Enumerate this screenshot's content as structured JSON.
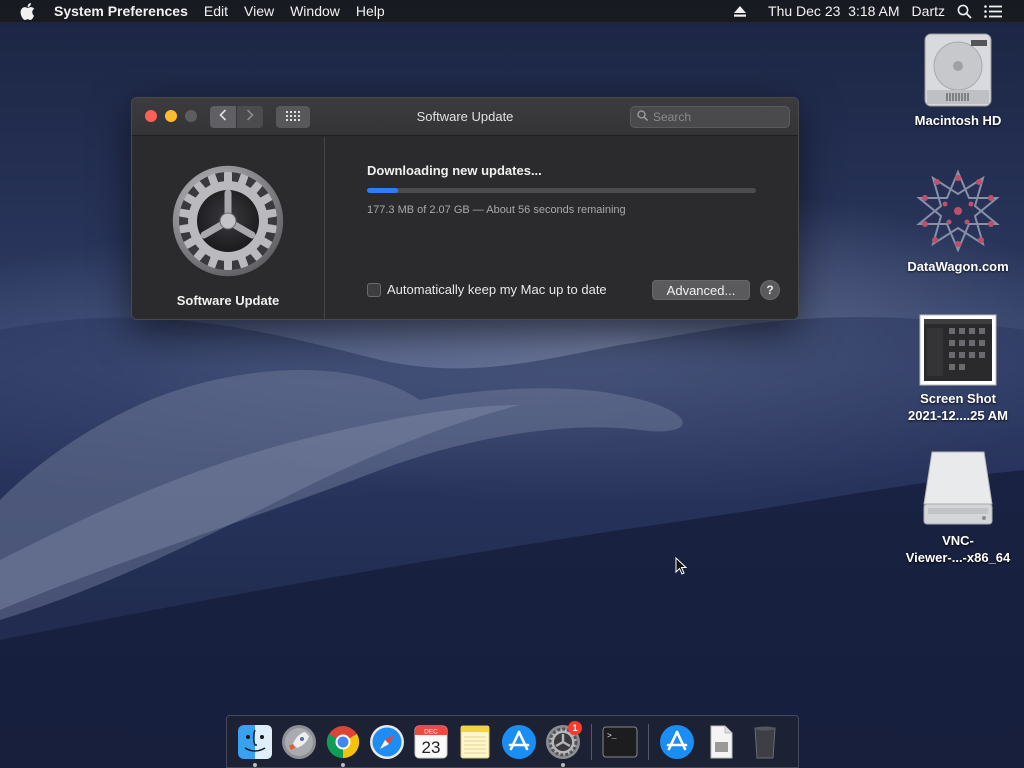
{
  "menubar": {
    "app_name": "System Preferences",
    "items": [
      "Edit",
      "View",
      "Window",
      "Help"
    ],
    "clock": "Thu Dec 23  3:18 AM",
    "user": "Dartz"
  },
  "window": {
    "title": "Software Update",
    "search_placeholder": "Search",
    "pane_label": "Software Update",
    "status_title": "Downloading new updates...",
    "progress_percent": 8,
    "progress_text": "177.3 MB of 2.07 GB — About 56 seconds remaining",
    "auto_update_label": "Automatically keep my Mac up to date",
    "auto_update_checked": false,
    "advanced_label": "Advanced...",
    "help_label": "?"
  },
  "desktop": {
    "icons": [
      {
        "label": "Macintosh HD",
        "icon": "hard-drive-icon"
      },
      {
        "label": "DataWagon.com",
        "icon": "datawagon-logo-icon"
      },
      {
        "label": "Screen Shot\n2021-12....25 AM",
        "icon": "screenshot-thumbnail-icon"
      },
      {
        "label": "VNC-\nViewer-...-x86_64",
        "icon": "disk-image-icon"
      }
    ]
  },
  "dock": {
    "calendar_month": "DEC",
    "calendar_day": "23",
    "badge_count": "1",
    "terminal_prompt": ">_"
  },
  "colors": {
    "accent": "#2f7cf6",
    "close": "#fe5f57",
    "minimize": "#febb2e",
    "badge": "#ff3b30"
  }
}
